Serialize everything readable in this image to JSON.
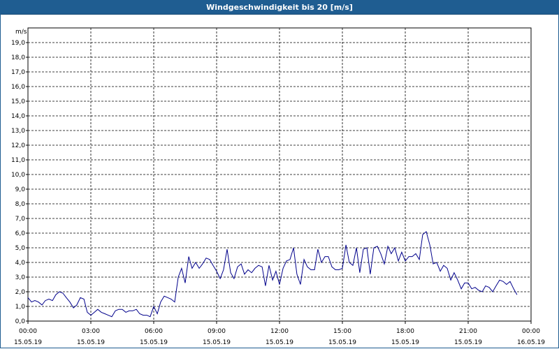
{
  "window": {
    "title": "Windgeschwindigkeit bis 20 [m/s]"
  },
  "colors": {
    "title_bar": "#1f5d91",
    "series": "#00008b",
    "grid": "#000000"
  },
  "chart_data": {
    "type": "line",
    "title": "Windgeschwindigkeit bis 20 [m/s]",
    "ylabel": "m/s",
    "ylim": [
      0,
      20
    ],
    "xlim_hours": [
      0,
      24
    ],
    "grid": true,
    "y_ticks": [
      "0,0",
      "1,0",
      "2,0",
      "3,0",
      "4,0",
      "5,0",
      "6,0",
      "7,0",
      "8,0",
      "9,0",
      "10,0",
      "11,0",
      "12,0",
      "13,0",
      "14,0",
      "15,0",
      "16,0",
      "17,0",
      "18,0",
      "19,0"
    ],
    "x_ticks": [
      {
        "time": "00:00",
        "date": "15.05.19"
      },
      {
        "time": "03:00",
        "date": "15.05.19"
      },
      {
        "time": "06:00",
        "date": "15.05.19"
      },
      {
        "time": "09:00",
        "date": "15.05.19"
      },
      {
        "time": "12:00",
        "date": "15.05.19"
      },
      {
        "time": "15:00",
        "date": "15.05.19"
      },
      {
        "time": "18:00",
        "date": "15.05.19"
      },
      {
        "time": "21:00",
        "date": "15.05.19"
      },
      {
        "time": "00:00",
        "date": "16.05.19"
      }
    ],
    "series": [
      {
        "x_hours": [
          0.0,
          0.17,
          0.33,
          0.5,
          0.67,
          0.83,
          1.0,
          1.17,
          1.33,
          1.5,
          1.67,
          1.83,
          2.0,
          2.17,
          2.33,
          2.5,
          2.67,
          2.83,
          3.0,
          3.17,
          3.33,
          3.5,
          3.67,
          3.83,
          4.0,
          4.17,
          4.33,
          4.5,
          4.67,
          4.83,
          5.0,
          5.17,
          5.33,
          5.5,
          5.67,
          5.83,
          6.0,
          6.17,
          6.33,
          6.5,
          6.67,
          6.83,
          7.0,
          7.17,
          7.33,
          7.5,
          7.67,
          7.83,
          8.0,
          8.17,
          8.33,
          8.5,
          8.67,
          8.83,
          9.0,
          9.17,
          9.33,
          9.5,
          9.67,
          9.83,
          10.0,
          10.17,
          10.33,
          10.5,
          10.67,
          10.83,
          11.0,
          11.17,
          11.33,
          11.5,
          11.67,
          11.83,
          12.0,
          12.17,
          12.33,
          12.5,
          12.67,
          12.83,
          13.0,
          13.17,
          13.33,
          13.5,
          13.67,
          13.83,
          14.0,
          14.17,
          14.33,
          14.5,
          14.67,
          14.83,
          15.0,
          15.17,
          15.33,
          15.5,
          15.67,
          15.83,
          16.0,
          16.17,
          16.33,
          16.5,
          16.67,
          16.83,
          17.0,
          17.17,
          17.33,
          17.5,
          17.67,
          17.83,
          18.0,
          18.17,
          18.33,
          18.5,
          18.67,
          18.83,
          19.0,
          19.17,
          19.33,
          19.5,
          19.67,
          19.83,
          20.0,
          20.17,
          20.33,
          20.5,
          20.67,
          20.83,
          21.0,
          21.17,
          21.33,
          21.5,
          21.67,
          21.83,
          22.0,
          22.17,
          22.33,
          22.5,
          22.67,
          22.83,
          23.0,
          23.17,
          23.33,
          23.5,
          23.67,
          23.83,
          24.0
        ],
        "y": [
          1.6,
          1.3,
          1.4,
          1.3,
          1.1,
          1.4,
          1.5,
          1.4,
          1.8,
          2.0,
          1.9,
          1.6,
          1.3,
          0.9,
          1.1,
          1.6,
          1.5,
          0.6,
          0.4,
          0.6,
          0.8,
          0.6,
          0.5,
          0.4,
          0.3,
          0.7,
          0.8,
          0.8,
          0.6,
          0.7,
          0.7,
          0.8,
          0.5,
          0.4,
          0.4,
          0.3,
          1.0,
          0.5,
          1.3,
          1.7,
          1.6,
          1.5,
          1.3,
          3.0,
          3.6,
          2.6,
          4.4,
          3.6,
          4.0,
          3.6,
          3.9,
          4.3,
          4.2,
          3.8,
          3.4,
          2.9,
          3.5,
          4.9,
          3.3,
          2.9,
          3.7,
          3.9,
          3.2,
          3.5,
          3.3,
          3.6,
          3.8,
          3.7,
          2.4,
          3.8,
          2.8,
          3.4,
          2.5,
          3.6,
          4.1,
          4.2,
          5.0,
          3.2,
          2.5,
          4.2,
          3.7,
          3.5,
          3.5,
          4.9,
          4.0,
          4.4,
          4.4,
          3.7,
          3.5,
          3.5,
          3.6,
          5.2,
          4.0,
          3.8,
          5.0,
          3.3,
          4.9,
          5.0,
          3.2,
          5.0,
          5.1,
          4.6,
          3.9,
          5.1,
          4.6,
          5.0,
          4.1,
          4.7,
          4.1,
          4.4,
          4.4,
          4.6,
          4.2,
          5.9,
          6.1,
          5.2,
          3.9,
          4.0,
          3.4,
          3.8,
          3.6,
          2.8,
          3.3,
          2.8,
          2.2,
          2.6,
          2.6,
          2.2,
          2.3,
          2.1,
          2.0,
          2.4,
          2.3,
          2.0,
          2.4,
          2.8,
          2.7,
          2.5,
          2.7,
          2.2,
          1.8
        ]
      }
    ]
  }
}
